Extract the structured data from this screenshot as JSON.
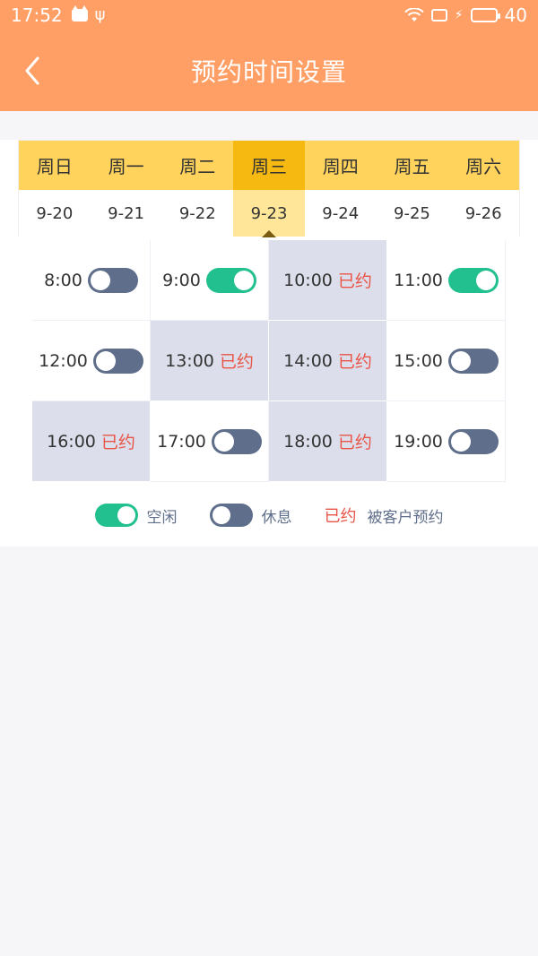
{
  "statusbar": {
    "time": "17:52",
    "battery": "40"
  },
  "navbar": {
    "title": "预约时间设置"
  },
  "week": {
    "days": [
      "周日",
      "周一",
      "周二",
      "周三",
      "周四",
      "周五",
      "周六"
    ],
    "dates": [
      "9-20",
      "9-21",
      "9-22",
      "9-23",
      "9-24",
      "9-25",
      "9-26"
    ],
    "selected_index": 3
  },
  "slots": [
    {
      "time": "8:00",
      "state": "off"
    },
    {
      "time": "9:00",
      "state": "on"
    },
    {
      "time": "10:00",
      "state": "booked",
      "tag": "已约"
    },
    {
      "time": "11:00",
      "state": "on"
    },
    {
      "time": "12:00",
      "state": "off"
    },
    {
      "time": "13:00",
      "state": "booked",
      "tag": "已约"
    },
    {
      "time": "14:00",
      "state": "booked",
      "tag": "已约"
    },
    {
      "time": "15:00",
      "state": "off"
    },
    {
      "time": "16:00",
      "state": "booked",
      "tag": "已约"
    },
    {
      "time": "17:00",
      "state": "off"
    },
    {
      "time": "18:00",
      "state": "booked",
      "tag": "已约"
    },
    {
      "time": "19:00",
      "state": "off"
    }
  ],
  "legend": {
    "free": "空闲",
    "rest": "休息",
    "booked_tag": "已约",
    "booked_desc": "被客户预约"
  },
  "colors": {
    "header": "#ff9f66",
    "week_bar": "#ffd35c",
    "selected_day": "#f6b912",
    "toggle_on": "#22c08e",
    "toggle_off": "#5f6e8a",
    "booked_bg": "#dcdfeb",
    "booked_text": "#e95447"
  }
}
